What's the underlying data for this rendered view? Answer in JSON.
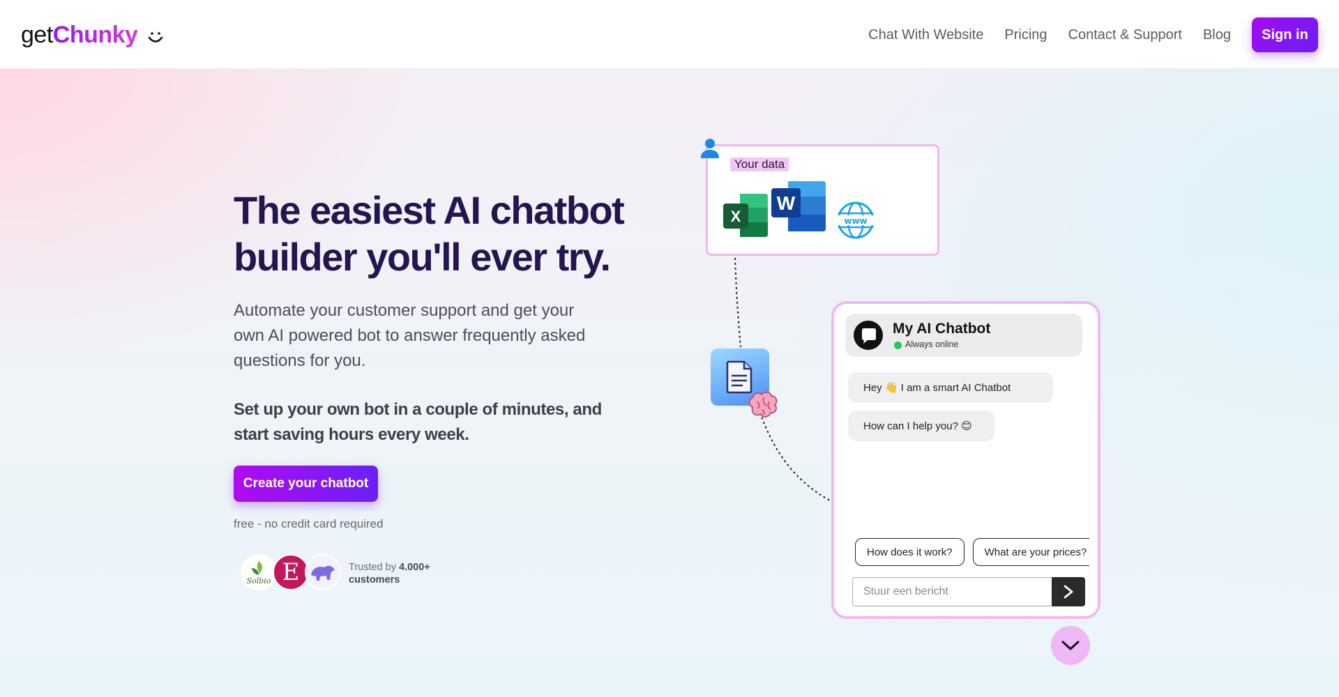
{
  "header": {
    "logo_prefix": "get",
    "logo_brand": "Chunky",
    "nav": [
      {
        "label": "Chat With Website"
      },
      {
        "label": "Pricing"
      },
      {
        "label": "Contact & Support"
      },
      {
        "label": "Blog"
      }
    ],
    "signin_label": "Sign in"
  },
  "hero": {
    "headline": "The easiest AI chatbot\nbuilder you'll ever try.",
    "lead": "Automate your customer support and get your\nown AI powered bot to answer frequently asked\nquestions for you.",
    "lead_bold": "Set up your own bot in a couple of minutes, and\nstart saving hours every week.",
    "cta_label": "Create your chatbot",
    "fineprint": "free - no credit card required",
    "trust_prefix": "Trusted by ",
    "trust_count": "4.000+",
    "trust_suffix": "customers",
    "avatar_letter": "E",
    "avatar_1_text": "Solbio"
  },
  "illustration": {
    "data_label": "Your data",
    "icons": [
      "user-icon",
      "excel-icon",
      "word-icon",
      "globe-icon",
      "document-icon",
      "brain-icon"
    ],
    "excel_letter": "X",
    "word_letter": "W",
    "globe_text": "www"
  },
  "chat": {
    "title": "My AI Chatbot",
    "status": "Always online",
    "messages": [
      {
        "text": "Hey 👋 I am a smart AI Chatbot"
      },
      {
        "text": "How can I help you? 😊"
      }
    ],
    "quick_replies": [
      {
        "label": "How does it work?"
      },
      {
        "label": "What are your prices?"
      }
    ],
    "input_placeholder": "Stuur een bericht"
  },
  "colors": {
    "accent": "#9c16ee",
    "headline": "#24154f",
    "card_border": "#efb6ef",
    "online": "#22c55e"
  }
}
